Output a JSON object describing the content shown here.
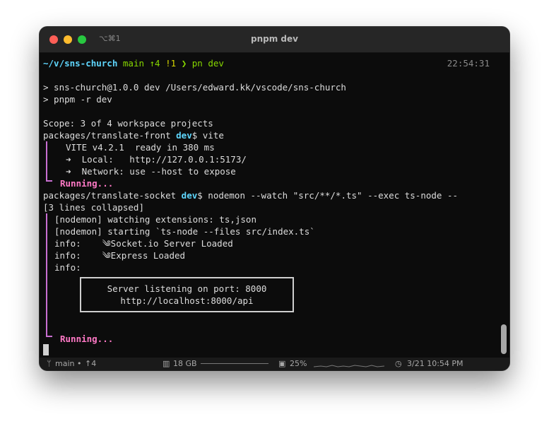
{
  "window": {
    "title": "pnpm dev",
    "shortcut": "⌥⌘1"
  },
  "prompt": {
    "path": "~/v/sns-church",
    "branch": "main",
    "ahead": "↑4",
    "modified": "!1",
    "arrow": "❯",
    "command": "pn dev",
    "time": "22:54:31"
  },
  "output": {
    "l1": "> sns-church@1.0.0 dev /Users/edward.kk/vscode/sns-church",
    "l2": "> pnpm -r dev",
    "l3": "Scope: 3 of 4 workspace projects",
    "l4_path": "packages/translate-front ",
    "l4_script": "dev",
    "l4_cmd": "$ vite",
    "l5": "VITE v4.2.1  ready in 380 ms",
    "l6": "➜  Local:   http://127.0.0.1:5173/",
    "l7": "➜  Network: use --host to expose",
    "running1": "Running...",
    "l9_path": "packages/translate-socket ",
    "l9_script": "dev",
    "l9_cmd": "$ nodemon --watch \"src/**/*.ts\" --exec ts-node --",
    "l10": "[3 lines collapsed]",
    "l11": "[nodemon] watching extensions: ts,json",
    "l12": "[nodemon] starting `ts-node --files src/index.ts`",
    "l13": "info:    ༄Socket.io Server Loaded",
    "l14": "info:    ༄Express Loaded",
    "l15": "info:",
    "box1": "Server listening on port: 8000",
    "box2": "http://localhost:8000/api",
    "running2": "Running..."
  },
  "status": {
    "branch": "main",
    "ahead": "↑4",
    "memory": "18 GB",
    "cpu": "25%",
    "datetime": "3/21 10:54 PM"
  },
  "colors": {
    "path": "#5fd7ff",
    "branch": "#87d700",
    "running": "#ff79c6",
    "background": "#0c0c0c"
  }
}
